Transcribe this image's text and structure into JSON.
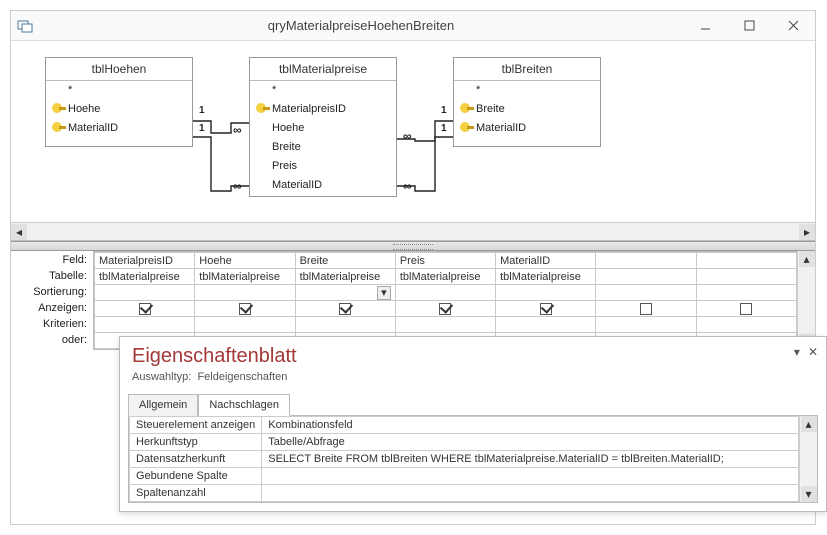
{
  "window": {
    "title": "qryMaterialpreiseHoehenBreiten"
  },
  "tables": {
    "t1": {
      "title": "tblHoehen",
      "star": "*",
      "f1": "Hoehe",
      "f2": "MaterialID"
    },
    "t2": {
      "title": "tblMaterialpreise",
      "star": "*",
      "f1": "MaterialpreisID",
      "f2": "Hoehe",
      "f3": "Breite",
      "f4": "Preis",
      "f5": "MaterialID"
    },
    "t3": {
      "title": "tblBreiten",
      "star": "*",
      "f1": "Breite",
      "f2": "MaterialID"
    }
  },
  "joins": {
    "one": "1",
    "many": "∞"
  },
  "gridLabels": {
    "field": "Feld:",
    "table": "Tabelle:",
    "sort": "Sortierung:",
    "show": "Anzeigen:",
    "criteria": "Kriterien:",
    "or": "oder:"
  },
  "grid": {
    "cols": [
      {
        "field": "MaterialpreisID",
        "table": "tblMaterialpreise",
        "show": true
      },
      {
        "field": "Hoehe",
        "table": "tblMaterialpreise",
        "show": true
      },
      {
        "field": "Breite",
        "table": "tblMaterialpreise",
        "show": true
      },
      {
        "field": "Preis",
        "table": "tblMaterialpreise",
        "show": true
      },
      {
        "field": "MaterialID",
        "table": "tblMaterialpreise",
        "show": true
      },
      {
        "field": "",
        "table": "",
        "show": false
      },
      {
        "field": "",
        "table": "",
        "show": false
      }
    ]
  },
  "propsheet": {
    "title": "Eigenschaftenblatt",
    "subtype_label": "Auswahltyp:",
    "subtype_value": "Feldeigenschaften",
    "tabs": {
      "general": "Allgemein",
      "lookup": "Nachschlagen"
    },
    "rows": {
      "r1k": "Steuerelement anzeigen",
      "r1v": "Kombinationsfeld",
      "r2k": "Herkunftstyp",
      "r2v": "Tabelle/Abfrage",
      "r3k": "Datensatzherkunft",
      "r3v": "SELECT Breite FROM tblBreiten WHERE tblMaterialpreise.MaterialID = tblBreiten.MaterialID;",
      "r4k": "Gebundene Spalte",
      "r4v": "",
      "r5k": "Spaltenanzahl",
      "r5v": ""
    }
  }
}
